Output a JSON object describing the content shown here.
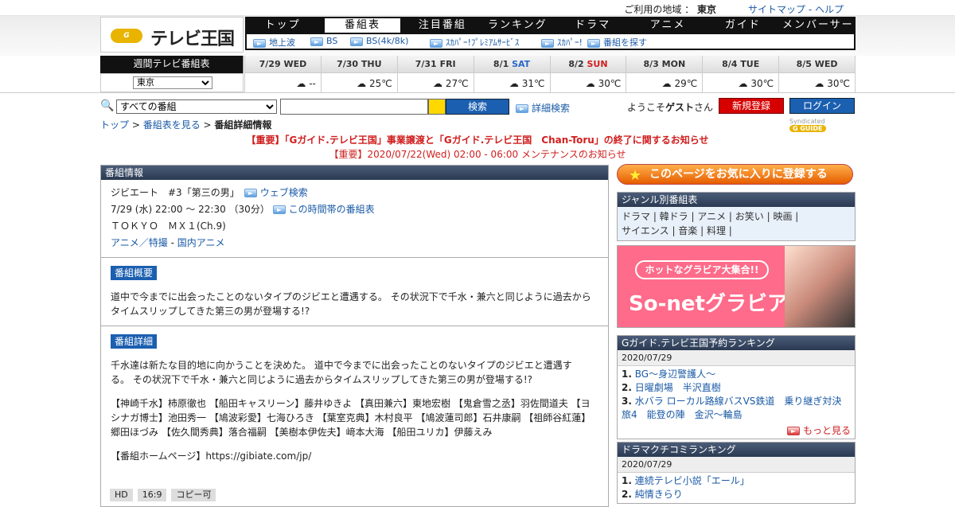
{
  "top": {
    "region_label": "ご利用の地域 ：",
    "region": "東京",
    "sitemap": "サイトマップ",
    "sep": "-",
    "help": "ヘルプ"
  },
  "logo": {
    "badge": "G GUIDE",
    "text": "テレビ王国"
  },
  "nav": [
    "トップ",
    "番組表",
    "注目番組",
    "ランキング",
    "ドラマ",
    "アニメ",
    "ガイド",
    "メンバーサービス"
  ],
  "subnav": [
    "地上波",
    "BS",
    "BS(4k/8k)",
    "ｽｶﾊﾟｰ!ﾌﾟﾚﾐｱﾑｻｰﾋﾞｽ",
    "ｽｶﾊﾟｰ!",
    "番組を探す"
  ],
  "weekly": {
    "title": "週間テレビ番組表",
    "area": "東京"
  },
  "days": [
    {
      "date": "7/29",
      "dow": "WED",
      "temp": "--",
      "cls": ""
    },
    {
      "date": "7/30",
      "dow": "THU",
      "temp": "25℃",
      "cls": ""
    },
    {
      "date": "7/31",
      "dow": "FRI",
      "temp": "27℃",
      "cls": ""
    },
    {
      "date": "8/1",
      "dow": "SAT",
      "temp": "31℃",
      "cls": "sat"
    },
    {
      "date": "8/2",
      "dow": "SUN",
      "temp": "30℃",
      "cls": "sun"
    },
    {
      "date": "8/3",
      "dow": "MON",
      "temp": "29℃",
      "cls": ""
    },
    {
      "date": "8/4",
      "dow": "TUE",
      "temp": "30℃",
      "cls": ""
    },
    {
      "date": "8/5",
      "dow": "WED",
      "temp": "30℃",
      "cls": ""
    }
  ],
  "search": {
    "scope": "すべての番組",
    "button": "検索",
    "advanced": "詳細検索"
  },
  "user": {
    "welcome": "ようこそ",
    "guest": "ゲスト",
    "san": "さん",
    "register": "新規登録",
    "login": "ログイン"
  },
  "crumb": {
    "top": "トップ",
    "sep1": " > ",
    "list": "番組表を見る",
    "sep2": " > ",
    "current": "番組詳細情報"
  },
  "syndicated": "Syndicated",
  "notices": [
    "【重要】「Gガイド.テレビ王国」事業譲渡と「Gガイド.テレビ王国　Chan-Toru」の終了に関するお知らせ",
    "【重要】2020/07/22(Wed) 02:00 - 06:00 メンテナンスのお知らせ"
  ],
  "program": {
    "header": "番組情報",
    "title": "ジビエート　#3「第三の男」",
    "web_search": "ウェブ検索",
    "time": "7/29 (水) 22:00 ～ 22:30 （30分）",
    "time_link": "この時間帯の番組表",
    "channel": "ＴＯＫＹＯ　ＭＸ１(Ch.9)",
    "genre1": "アニメ／特撮",
    "genre_sep": " - ",
    "genre2": "国内アニメ",
    "summary_tag": "番組概要",
    "summary": "道中で今までに出会ったことのないタイプのジビエと遭遇する。 その状況下で千水・兼六と同じように過去からタイムスリップしてきた第三の男が登場する!?",
    "detail_tag": "番組詳細",
    "detail": "千水達は新たな目的地に向かうことを決めた。 道中で今までに出会ったことのないタイプのジビエと遭遇する。 その状況下で千水・兼六と同じように過去からタイムスリップしてきた第三の男が登場する!?",
    "cast": "【神崎千水】柿原徹也 【船田キャスリーン】藤井ゆきよ 【真田兼六】東地宏樹 【鬼倉雪之丞】羽佐間道夫 【ヨシナガ博士】池田秀一 【鳩波彩愛】七海ひろき 【葉室克典】木村良平 【鳩波蓮司郎】石井康嗣 【祖師谷紅蓮】郷田ほづみ 【佐久間秀典】落合福嗣 【美樹本伊佐夫】﨑本大海 【船田ユリカ】伊藤えみ",
    "homepage": "【番組ホームページ】https://gibiate.com/jp/",
    "tags": [
      "HD",
      "16:9",
      "コピー可"
    ]
  },
  "sidebar": {
    "fav": "このページをお気に入りに登録する",
    "genre_header": "ジャンル別番組表",
    "genre_line1": "ドラマ | 韓ドラ | アニメ | お笑い | 映画 |",
    "genre_line2": "サイエンス | 音楽 | 料理 |",
    "ad_pill": "ホットなグラビア大集合!!",
    "ad_big": "So-netグラビア",
    "rank1_header": "Gガイド.テレビ王国予約ランキング",
    "rank1_date": "2020/07/29",
    "rank1": [
      "BG～身辺警護人～",
      "日曜劇場　半沢直樹",
      "水バラ ローカル路線バスVS鉄道　乗り継ぎ対決旅4　能登の陣　金沢〜輪島"
    ],
    "more": "もっと見る",
    "rank2_header": "ドラマクチコミランキング",
    "rank2_date": "2020/07/29",
    "rank2": [
      "連続テレビ小説「エール」",
      "純情きらり"
    ]
  }
}
